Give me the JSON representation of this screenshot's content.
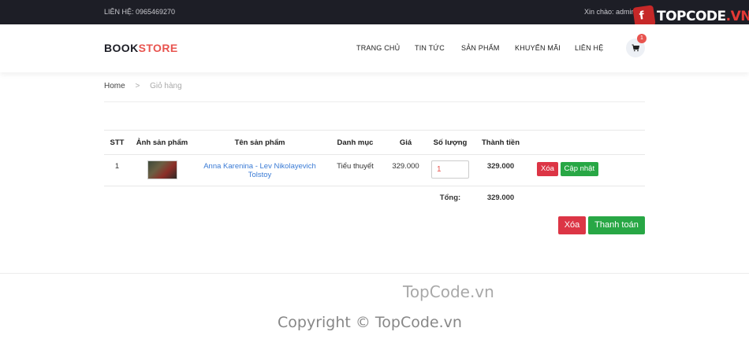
{
  "topbar": {
    "contact": "LIÊN HỆ: 0965469270",
    "greeting": "Xin chào: admin"
  },
  "watermark": {
    "logo_badge": "f",
    "logo_text_a": "TOPCODE",
    "logo_text_b": ".VN",
    "center": "TopCode.vn",
    "copyright": "Copyright © TopCode.vn"
  },
  "header": {
    "logo_part1": "BOOK",
    "logo_part2": "STORE",
    "nav": [
      "TRANG CHỦ",
      "TIN TỨC",
      "SẢN PHẨM",
      "KHUYẾN MÃI",
      "LIÊN HỆ"
    ],
    "cart_count": "1",
    "cart_icon": "shopping-cart-icon"
  },
  "breadcrumb": {
    "home": "Home",
    "separator": ">",
    "current": "Giỏ hàng"
  },
  "cart_table": {
    "headers": [
      "STT",
      "Ảnh sản phẩm",
      "Tên sản phẩm",
      "Danh mục",
      "Giá",
      "Số lượng",
      "Thành tiền"
    ],
    "rows": [
      {
        "index": "1",
        "name": "Anna Karenina - Lev Nikolayevich Tolstoy",
        "category": "Tiểu thuyết",
        "price": "329.000",
        "quantity": "1",
        "subtotal": "329.000",
        "delete_label": "Xóa",
        "update_label": "Cập nhật"
      }
    ],
    "total_label": "Tổng:",
    "total_value": "329.000"
  },
  "actions": {
    "delete_all_label": "Xóa",
    "checkout_label": "Thanh toán"
  },
  "colors": {
    "topbar_bg": "#1d1e26",
    "accent": "#e8544f",
    "link": "#3a7bd5",
    "danger": "#dc3545",
    "success": "#28a745"
  }
}
